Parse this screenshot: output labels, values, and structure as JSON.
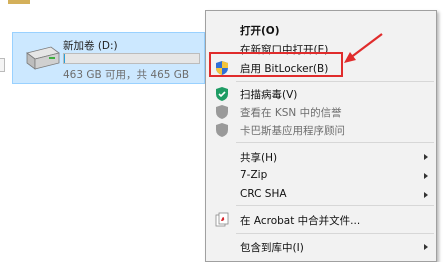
{
  "drive": {
    "name": "新加卷 (D:)",
    "space_text": "463 GB 可用，共 465 GB",
    "used_fraction": 0.004,
    "icon": "hard-drive-icon"
  },
  "context_menu": {
    "items": [
      {
        "label": "打开(O)"
      },
      {
        "label": "在新窗口中打开(E)"
      },
      {
        "label": "启用 BitLocker(B)",
        "icon": "shield-icon"
      },
      {
        "label": "扫描病毒(V)",
        "icon": "kaspersky-scan-icon"
      },
      {
        "label": "查看在 KSN 中的信誉",
        "icon": "kaspersky-shield-icon"
      },
      {
        "label": "卡巴斯基应用程序顾问",
        "icon": "kaspersky-shield-icon"
      },
      {
        "label": "共享(H)"
      },
      {
        "label": "7-Zip"
      },
      {
        "label": "CRC SHA"
      },
      {
        "label": "在 Acrobat 中合并文件...",
        "icon": "acrobat-icon"
      },
      {
        "label": "包含到库中(I)"
      }
    ]
  },
  "annotation": {
    "highlight_color": "#e02c2c"
  },
  "colors": {
    "selection_bg": "#cce8ff",
    "selection_border": "#99d1ff",
    "menu_bg": "#f2f2f2",
    "kaspersky_green": "#1e9c64",
    "disabled_gray": "#9a9a9a"
  }
}
